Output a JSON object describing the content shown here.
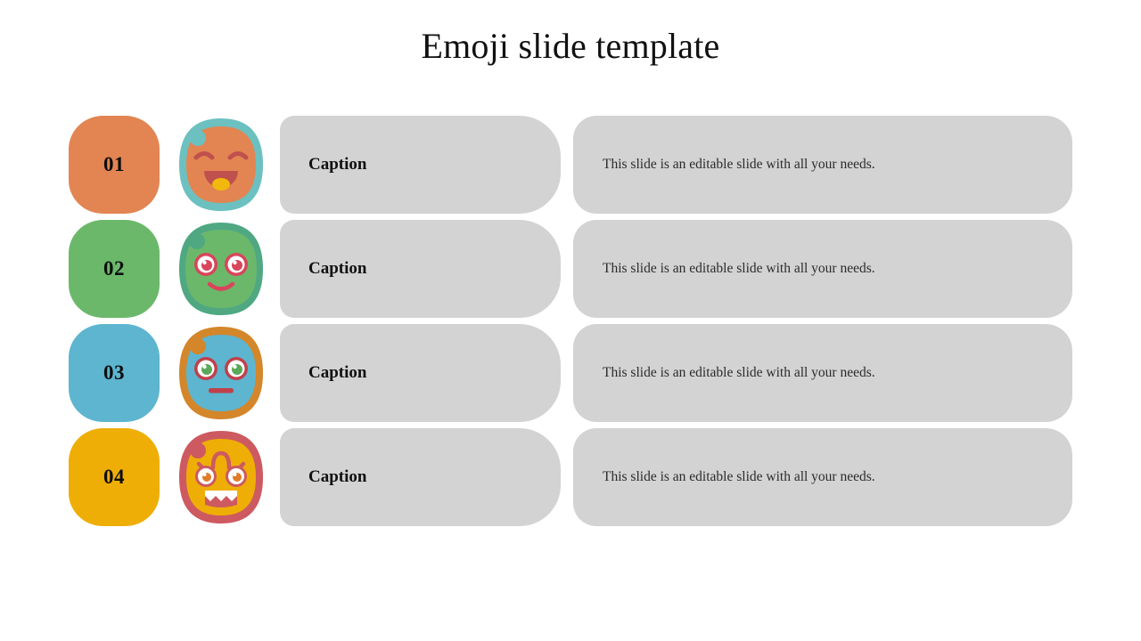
{
  "slide": {
    "title": "Emoji slide template",
    "background": "#ffffff"
  },
  "colors": {
    "box_gray": "#d3d3d3",
    "text_dark": "#111111",
    "text_body": "#2b2b2b"
  },
  "rows": [
    {
      "number": "01",
      "tile_color": "#e28552",
      "caption": "Caption",
      "description": "This slide is an editable slide with all your needs.",
      "emoji": {
        "name": "laughing-face-emoji",
        "ring_color": "#6cc0c0",
        "face_color": "#e28552",
        "feature_color": "#c0504d",
        "accent_color": "#f0b90b",
        "expression": "laughing"
      }
    },
    {
      "number": "02",
      "tile_color": "#6bb86b",
      "caption": "Caption",
      "description": "This slide is an editable slide with all your needs.",
      "emoji": {
        "name": "smiling-face-emoji",
        "ring_color": "#4fa882",
        "face_color": "#6bb86b",
        "feature_color": "#d9455a",
        "accent_color": "#ffffff",
        "expression": "smiling"
      }
    },
    {
      "number": "03",
      "tile_color": "#5db5d0",
      "caption": "Caption",
      "description": "This slide is an editable slide with all your needs.",
      "emoji": {
        "name": "neutral-face-emoji",
        "ring_color": "#d4862a",
        "face_color": "#5db5d0",
        "feature_color": "#c0404a",
        "accent_color": "#5aa85a",
        "expression": "neutral"
      }
    },
    {
      "number": "04",
      "tile_color": "#efae06",
      "caption": "Caption",
      "description": "This slide is an editable slide with all your needs.",
      "emoji": {
        "name": "scared-face-emoji",
        "ring_color": "#cd5a60",
        "face_color": "#efae06",
        "feature_color": "#cd5a60",
        "accent_color": "#e07b28",
        "expression": "scared"
      }
    }
  ]
}
